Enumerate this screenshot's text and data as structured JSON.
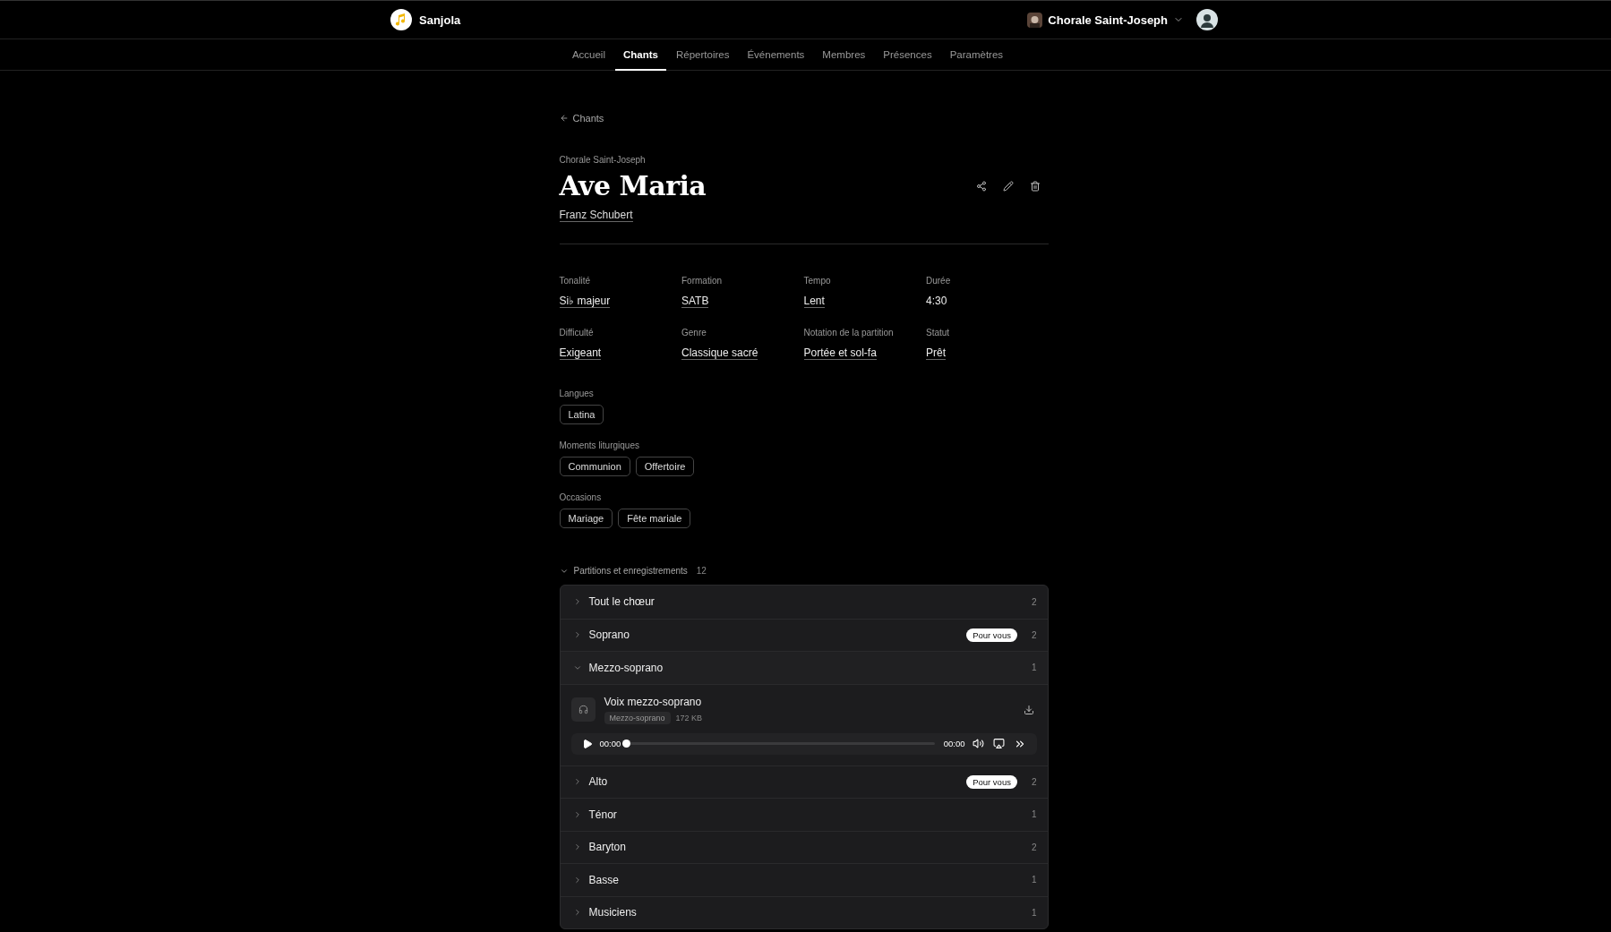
{
  "app": {
    "name": "Sanjola"
  },
  "org_switcher": {
    "label": "Chorale Saint-Joseph"
  },
  "nav": [
    {
      "label": "Accueil",
      "selected": false
    },
    {
      "label": "Chants",
      "selected": true
    },
    {
      "label": "Répertoires",
      "selected": false
    },
    {
      "label": "Événements",
      "selected": false
    },
    {
      "label": "Membres",
      "selected": false
    },
    {
      "label": "Présences",
      "selected": false
    },
    {
      "label": "Paramètres",
      "selected": false
    }
  ],
  "back_link": "Chants",
  "song": {
    "organization": "Chorale Saint-Joseph",
    "title": "Ave Maria",
    "composer": "Franz Schubert"
  },
  "details": [
    {
      "label": "Tonalité",
      "value": "Si♭ majeur",
      "linked": true
    },
    {
      "label": "Formation",
      "value": "SATB",
      "linked": true
    },
    {
      "label": "Tempo",
      "value": "Lent",
      "linked": true
    },
    {
      "label": "Durée",
      "value": "4:30",
      "linked": false
    },
    {
      "label": "Difficulté",
      "value": "Exigeant",
      "linked": true
    },
    {
      "label": "Genre",
      "value": "Classique sacré",
      "linked": true
    },
    {
      "label": "Notation de la partition",
      "value": "Portée et sol-fa",
      "linked": true
    },
    {
      "label": "Statut",
      "value": "Prêt",
      "linked": true
    }
  ],
  "tag_groups": [
    {
      "label": "Langues",
      "tags": [
        "Latina"
      ]
    },
    {
      "label": "Moments liturgiques",
      "tags": [
        "Communion",
        "Offertoire"
      ]
    },
    {
      "label": "Occasions",
      "tags": [
        "Mariage",
        "Fête mariale"
      ]
    }
  ],
  "scores": {
    "title": "Partitions et enregistrements",
    "count": "12",
    "expanded": true,
    "groups": [
      {
        "name": "Tout le chœur",
        "count": "2",
        "expanded": false
      },
      {
        "name": "Soprano",
        "count": "2",
        "badge": "Pour vous",
        "expanded": false
      },
      {
        "name": "Mezzo-soprano",
        "count": "1",
        "expanded": true,
        "files": [
          {
            "title": "Voix mezzo-soprano",
            "part": "Mezzo-soprano",
            "size": "172 KB",
            "player": {
              "current": "00:00",
              "total": "00:00",
              "level": 0
            }
          }
        ]
      },
      {
        "name": "Alto",
        "count": "2",
        "badge": "Pour vous",
        "expanded": false
      },
      {
        "name": "Ténor",
        "count": "1",
        "expanded": false
      },
      {
        "name": "Baryton",
        "count": "2",
        "expanded": false
      },
      {
        "name": "Basse",
        "count": "1",
        "expanded": false
      },
      {
        "name": "Musiciens",
        "count": "1",
        "expanded": false
      }
    ]
  }
}
